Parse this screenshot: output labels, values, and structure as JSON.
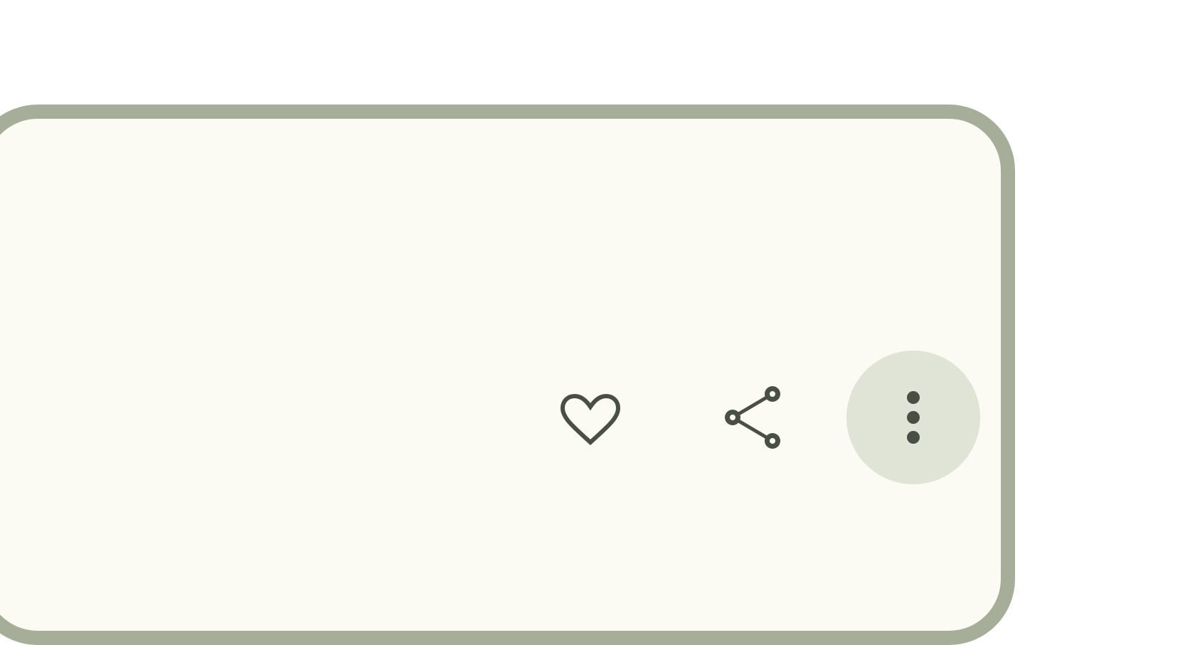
{
  "card": {
    "border_color": "#a6ae9a",
    "background_color": "#fbfbf3"
  },
  "actions": [
    {
      "name": "favorite",
      "icon": "heart-outline-icon",
      "highlighted": false
    },
    {
      "name": "share",
      "icon": "share-icon",
      "highlighted": false
    },
    {
      "name": "more-options",
      "icon": "more-vertical-icon",
      "highlighted": true
    }
  ],
  "colors": {
    "icon": "#4a4f45",
    "highlight": "#e0e4d7",
    "page_background": "#ffffff"
  }
}
